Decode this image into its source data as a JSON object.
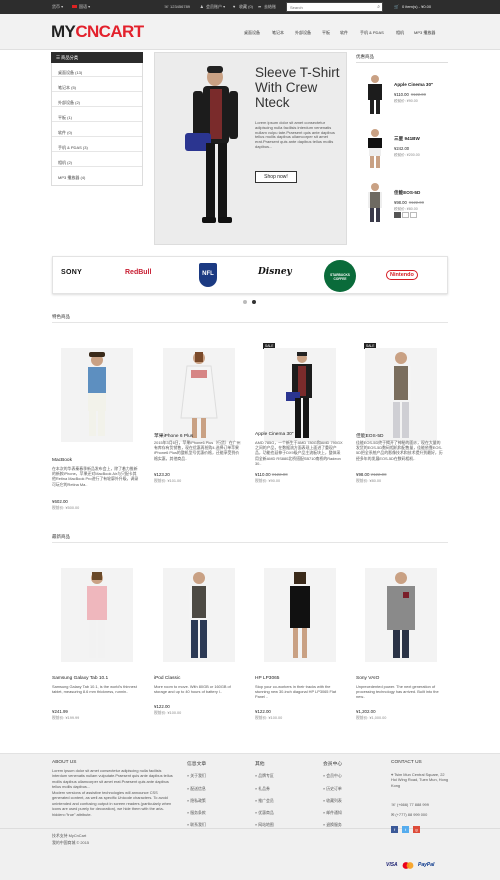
{
  "topbar": {
    "currency": "货币 ▾",
    "language": "国语 ▾",
    "phone": "123456789",
    "account": "会员账户 ▾",
    "wishlist": "收藏 (0)",
    "checkout": "去结账",
    "search_placeholder": "Search",
    "cart": "0 item(s) - ¥0.00"
  },
  "logo": {
    "part1": "MY",
    "part2": "CNCART"
  },
  "nav": [
    "桌面设备",
    "笔记本",
    "外部设备",
    "平板",
    "软件",
    "手机 & PDAS",
    "相机",
    "MP3 播放器"
  ],
  "categories": {
    "title": "商品分类",
    "items": [
      "桌面设备 (13)",
      "笔记本 (5)",
      "外部设备 (2)",
      "平板 (1)",
      "软件 (0)",
      "手机 & PDAS (3)",
      "相机 (2)",
      "MP3 播放器 (4)"
    ]
  },
  "hero": {
    "heading": "Sleeve T-Shirt With Crew Nteck",
    "text": "Lorem ipsum dolor sit amet consectetur adipiscing nulla facilisis interdum venenatis nullam vulpu tate.Praesent quis ante dapibus tellus mollis dapibus ullamcorper sit amet erat.Praesent quis ante dapibus tellus mollis dapibus...",
    "button": "Shop now!"
  },
  "specials": {
    "title": "优惠商品",
    "items": [
      {
        "name": "Apple Cinema 30\"",
        "price": "¥110.00",
        "old": "¥122.00",
        "tax": "税前价: ¥90.00"
      },
      {
        "name": "三星 941BW",
        "price": "¥242.00",
        "old": "",
        "tax": "税前价: ¥200.00"
      },
      {
        "name": "佳能EOS-5D",
        "price": "¥98.00",
        "old": "¥122.00",
        "tax": "税前价: ¥80.00"
      }
    ]
  },
  "brands": [
    "SONY",
    "RedBull",
    "NFL",
    "Disney",
    "STARBUCKS COFFEE",
    "Nintendo"
  ],
  "featured": {
    "title": "特色商品",
    "items": [
      {
        "name": "MacBook",
        "desc": "在本次的华表秦春季新品发布会上，除了着力推新的新款iPhone，苹果还对MacBook Air与只配卡其他Retina MacBook Pro进行了有轮廓外升级，调录可玩它的Retina Ma..",
        "price": "¥602.00",
        "tax": "税前价: ¥500.00",
        "sale": ""
      },
      {
        "name": "苹果iPhone 6 Plus",
        "desc": "2015年3月6日，苹果iPhone6 Plus（行货）在广州有库存有货销售，现在优惠再抢购4.选择订单苹果iPhone6 Plus的整机型号优惠价格，还能享受到价格实惠，其他商品..",
        "price": "¥123.20",
        "tax": "税前价: ¥101.00",
        "sale": ""
      },
      {
        "name": "Apple Cinema 30\"",
        "desc": "AMD 785G，一个新生于AMD 780G和AMD 790GX之间的产品，在数据流方面表现上面进了重现产品，功能也延伸于DX9级产品主流板块上，整体采用全新AMD RS880北桥搭配SB710南桥的Radeon 30..",
        "price": "¥110.00",
        "old": "¥122.00",
        "tax": "税前价: ¥90.00",
        "sale": "SALE"
      },
      {
        "name": "佳能EOS-5D",
        "desc": "佳能EOS-5D终于揭开了神秘的面纱，现在大量的发货的EOS-5D数码相机和配售量，佳能依靠EOS-5D把全系统产品的影像技术和技术提升到最好，历经多年的发展EOS-5D在数码相机..",
        "price": "¥98.00",
        "old": "¥122.00",
        "tax": "税前价: ¥80.00",
        "sale": "SALE"
      }
    ]
  },
  "latest": {
    "title": "最新商品",
    "items": [
      {
        "name": "Samsung Galaxy Tab 10.1",
        "desc": "Samsung Galaxy Tab 10.1, is the world's thinnest tablet, measuring 8.6 mm thickness, runnin..",
        "price": "¥241.99",
        "tax": "税前价: ¥199.99"
      },
      {
        "name": "iPod Classic",
        "desc": "More room to move. With 80GB or 160GB of storage and up to 40 hours of battery l..",
        "price": "¥122.00",
        "tax": "税前价: ¥100.00"
      },
      {
        "name": "HP LP3065",
        "desc": "Stop your co-workers in their tracks with the stunning new 30-inch diagonal HP LP3065 Flat Panel ..",
        "price": "¥122.00",
        "tax": "税前价: ¥100.00"
      },
      {
        "name": "Sony VAIO",
        "desc": "Unprecedented power. The next generation of processing technology has arrived. Built into the new..",
        "price": "¥1,202.00",
        "tax": "税前价: ¥1,000.00"
      }
    ]
  },
  "footer": {
    "about_title": "ABOUT US",
    "about_text": "Lorem ipsum dolor sit amet consectetur adipiscing nulla facilisis interdum venenatis nullam vulputate.Praesent quis ante dapibus tellus mollis dapibus ullamcorper sit amet erat.Praesent quis ante dapibus tellus mollis dapibus...",
    "about_text2": "Modern versions of assistive technologies will announce CSS generated content, as well as specific Unicode characters. To avoid unintended and confusing output in screen readers (particularly when icons are used purely for decoration), we hide them with the aria-hidden=\"true\" attribute.",
    "col2_title": "信息文章",
    "col2": [
      "关于我们",
      "配送信息",
      "隐私政策",
      "服务条款",
      "联系我们"
    ],
    "col3_title": "其他",
    "col3": [
      "品牌专区",
      "礼品券",
      "推广会员",
      "优惠商品",
      "网站地图"
    ],
    "col4_title": "会员中心",
    "col4": [
      "会员中心",
      "历史订单",
      "收藏列表",
      "邮件通知",
      "退换服务"
    ],
    "contact_title": "CONTACT US",
    "address": "Tsim Mun Central Square, 22 Hoi Wing Road, Tuen Mun, Hong Kong",
    "phone": "(+666) 77 888 999",
    "email": "(+777) 88 999 000",
    "powered": "技术支持 MyCnCart",
    "copyright": "我的中国商城 © 2015",
    "payments": [
      "VISA",
      "MasterCard",
      "PayPal"
    ]
  }
}
